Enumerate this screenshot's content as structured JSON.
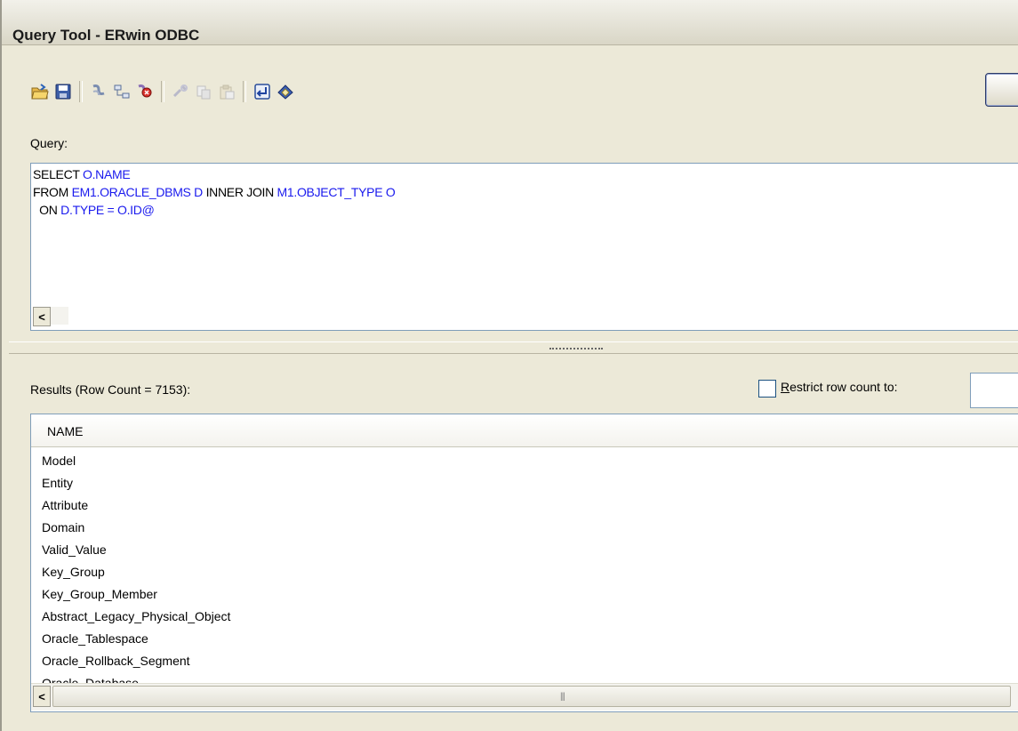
{
  "window": {
    "title": "Query Tool - ERwin ODBC"
  },
  "toolbar": {
    "buttons": [
      {
        "icon": "open-folder-icon"
      },
      {
        "icon": "save-disk-icon"
      },
      {
        "icon": "connect-icon"
      },
      {
        "icon": "schema-icon"
      },
      {
        "icon": "disconnect-icon"
      },
      {
        "icon": "tools-icon"
      },
      {
        "icon": "copy-icon"
      },
      {
        "icon": "paste-icon"
      },
      {
        "icon": "execute-icon"
      },
      {
        "icon": "eraser-icon"
      }
    ]
  },
  "query": {
    "label": "Query:",
    "lines": [
      [
        {
          "t": "SELECT ",
          "c": "kw"
        },
        {
          "t": "O.NAME",
          "c": "id"
        }
      ],
      [
        {
          "t": "FROM ",
          "c": "kw"
        },
        {
          "t": "EM1.ORACLE_DBMS D",
          "c": "id"
        },
        {
          "t": " INNER JOIN ",
          "c": "kw"
        },
        {
          "t": "M1.OBJECT_TYPE O",
          "c": "id"
        }
      ],
      [
        {
          "t": "  ON ",
          "c": "kw"
        },
        {
          "t": "D.TYPE = O.ID@",
          "c": "id"
        }
      ]
    ]
  },
  "results": {
    "label": "Results (Row Count = 7153):",
    "restrict_label": "Restrict row count to:",
    "restrict_checked": false,
    "columns": [
      "NAME"
    ],
    "rows": [
      "Model",
      "Entity",
      "Attribute",
      "Domain",
      "Valid_Value",
      "Key_Group",
      "Key_Group_Member",
      "Abstract_Legacy_Physical_Object",
      "Oracle_Tablespace",
      "Oracle_Rollback_Segment",
      "Oracle_Database"
    ]
  },
  "colors": {
    "keyword": "#000000",
    "identifier": "#1a1aee"
  }
}
